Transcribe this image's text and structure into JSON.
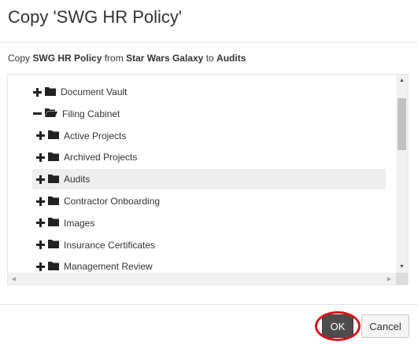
{
  "dialog": {
    "title": "Copy 'SWG HR Policy'",
    "subtitle": {
      "prefix": "Copy",
      "item": "SWG HR Policy",
      "from_word": "from",
      "source": "Star Wars Galaxy",
      "to_word": "to",
      "destination": "Audits"
    }
  },
  "tree": {
    "items": [
      {
        "label": "Document Vault",
        "state": "collapsed",
        "depth": 0
      },
      {
        "label": "Filing Cabinet",
        "state": "expanded",
        "depth": 0
      },
      {
        "label": "Active Projects",
        "state": "collapsed",
        "depth": 1
      },
      {
        "label": "Archived Projects",
        "state": "collapsed",
        "depth": 1
      },
      {
        "label": "Audits",
        "state": "collapsed",
        "depth": 1,
        "selected": true
      },
      {
        "label": "Contractor Onboarding",
        "state": "collapsed",
        "depth": 1
      },
      {
        "label": "Images",
        "state": "collapsed",
        "depth": 1
      },
      {
        "label": "Insurance Certificates",
        "state": "collapsed",
        "depth": 1
      },
      {
        "label": "Management Review",
        "state": "collapsed",
        "depth": 1
      }
    ]
  },
  "buttons": {
    "ok": "OK",
    "cancel": "Cancel"
  },
  "colors": {
    "ok_bg": "#4d4d4d",
    "highlight_ring": "#d9111b",
    "selected_row": "#eeeeee"
  }
}
